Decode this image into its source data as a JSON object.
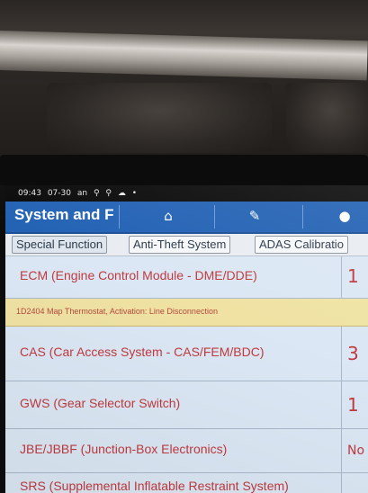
{
  "status_bar": {
    "time": "09:43",
    "date": "07-30",
    "indicator": "an",
    "icons": [
      "usb-icon",
      "usb-icon",
      "cloud-icon",
      "dot-icon"
    ]
  },
  "header": {
    "title": "System and F",
    "buttons": [
      {
        "name": "home-icon",
        "glyph": "⌂"
      },
      {
        "name": "edit-note-icon",
        "glyph": "✎"
      },
      {
        "name": "user-icon",
        "glyph": "●"
      }
    ]
  },
  "tabs": [
    {
      "label": "Special Function"
    },
    {
      "label": "Anti-Theft System"
    },
    {
      "label": "ADAS Calibratio"
    }
  ],
  "rows": [
    {
      "label": "ECM (Engine Control Module - DME/DDE)",
      "count": "1"
    },
    {
      "label": "CAS (Car Access System - CAS/FEM/BDC)",
      "count": "3"
    },
    {
      "label": "GWS (Gear Selector Switch)",
      "count": "1"
    },
    {
      "label": "JBE/JBBF (Junction-Box Electronics)",
      "count": "No"
    },
    {
      "label": "SRS (Supplemental Inflatable Restraint System)",
      "count": ""
    }
  ],
  "dtc": {
    "text": "1D2404 Map Thermostat, Activation: Line Disconnection"
  },
  "colors": {
    "header_blue": "#2362b4",
    "row_text_red": "#c03a3e",
    "dtc_yellow": "#efe2a3"
  }
}
